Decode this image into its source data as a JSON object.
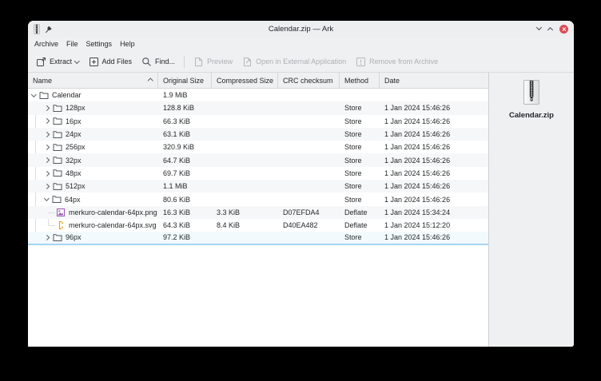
{
  "window": {
    "title": "Calendar.zip — Ark"
  },
  "menu": {
    "items": [
      "Archive",
      "File",
      "Settings",
      "Help"
    ]
  },
  "toolbar": {
    "extract": "Extract",
    "add_files": "Add Files",
    "find": "Find...",
    "preview": "Preview",
    "open_external": "Open in External Application",
    "remove": "Remove from Archive"
  },
  "table": {
    "columns": [
      "Name",
      "Original Size",
      "Compressed Size",
      "CRC checksum",
      "Method",
      "Date"
    ],
    "rows": [
      {
        "name": "Calendar",
        "original_size": "1.9 MiB",
        "compressed_size": "",
        "crc": "",
        "method": "",
        "date": ""
      },
      {
        "name": "128px",
        "original_size": "128.8 KiB",
        "compressed_size": "",
        "crc": "",
        "method": "Store",
        "date": "1 Jan 2024 15:46:26"
      },
      {
        "name": "16px",
        "original_size": "66.3 KiB",
        "compressed_size": "",
        "crc": "",
        "method": "Store",
        "date": "1 Jan 2024 15:46:26"
      },
      {
        "name": "24px",
        "original_size": "63.1 KiB",
        "compressed_size": "",
        "crc": "",
        "method": "Store",
        "date": "1 Jan 2024 15:46:26"
      },
      {
        "name": "256px",
        "original_size": "320.9 KiB",
        "compressed_size": "",
        "crc": "",
        "method": "Store",
        "date": "1 Jan 2024 15:46:26"
      },
      {
        "name": "32px",
        "original_size": "64.7 KiB",
        "compressed_size": "",
        "crc": "",
        "method": "Store",
        "date": "1 Jan 2024 15:46:26"
      },
      {
        "name": "48px",
        "original_size": "69.7 KiB",
        "compressed_size": "",
        "crc": "",
        "method": "Store",
        "date": "1 Jan 2024 15:46:26"
      },
      {
        "name": "512px",
        "original_size": "1.1 MiB",
        "compressed_size": "",
        "crc": "",
        "method": "Store",
        "date": "1 Jan 2024 15:46:26"
      },
      {
        "name": "64px",
        "original_size": "80.6 KiB",
        "compressed_size": "",
        "crc": "",
        "method": "Store",
        "date": "1 Jan 2024 15:46:26"
      },
      {
        "name": "merkuro-calendar-64px.png",
        "original_size": "16.3 KiB",
        "compressed_size": "3.3 KiB",
        "crc": "D07EFDA4",
        "method": "Deflate",
        "date": "1 Jan 2024 15:34:24"
      },
      {
        "name": "merkuro-calendar-64px.svg",
        "original_size": "64.3 KiB",
        "compressed_size": "8.4 KiB",
        "crc": "D40EA482",
        "method": "Deflate",
        "date": "1 Jan 2024 15:12:20"
      },
      {
        "name": "96px",
        "original_size": "97.2 KiB",
        "compressed_size": "",
        "crc": "",
        "method": "Store",
        "date": "1 Jan 2024 15:46:26"
      }
    ]
  },
  "side_panel": {
    "file_name": "Calendar.zip"
  },
  "colors": {
    "accent": "#3daee9",
    "close_button": "#dc4a56",
    "selection_underline": "#a4d6f2",
    "zebra_row": "#f6f7f8",
    "folder_icon": "#51585c",
    "png_icon": "#9b59b6",
    "svg_icon": "#e3a51a"
  }
}
